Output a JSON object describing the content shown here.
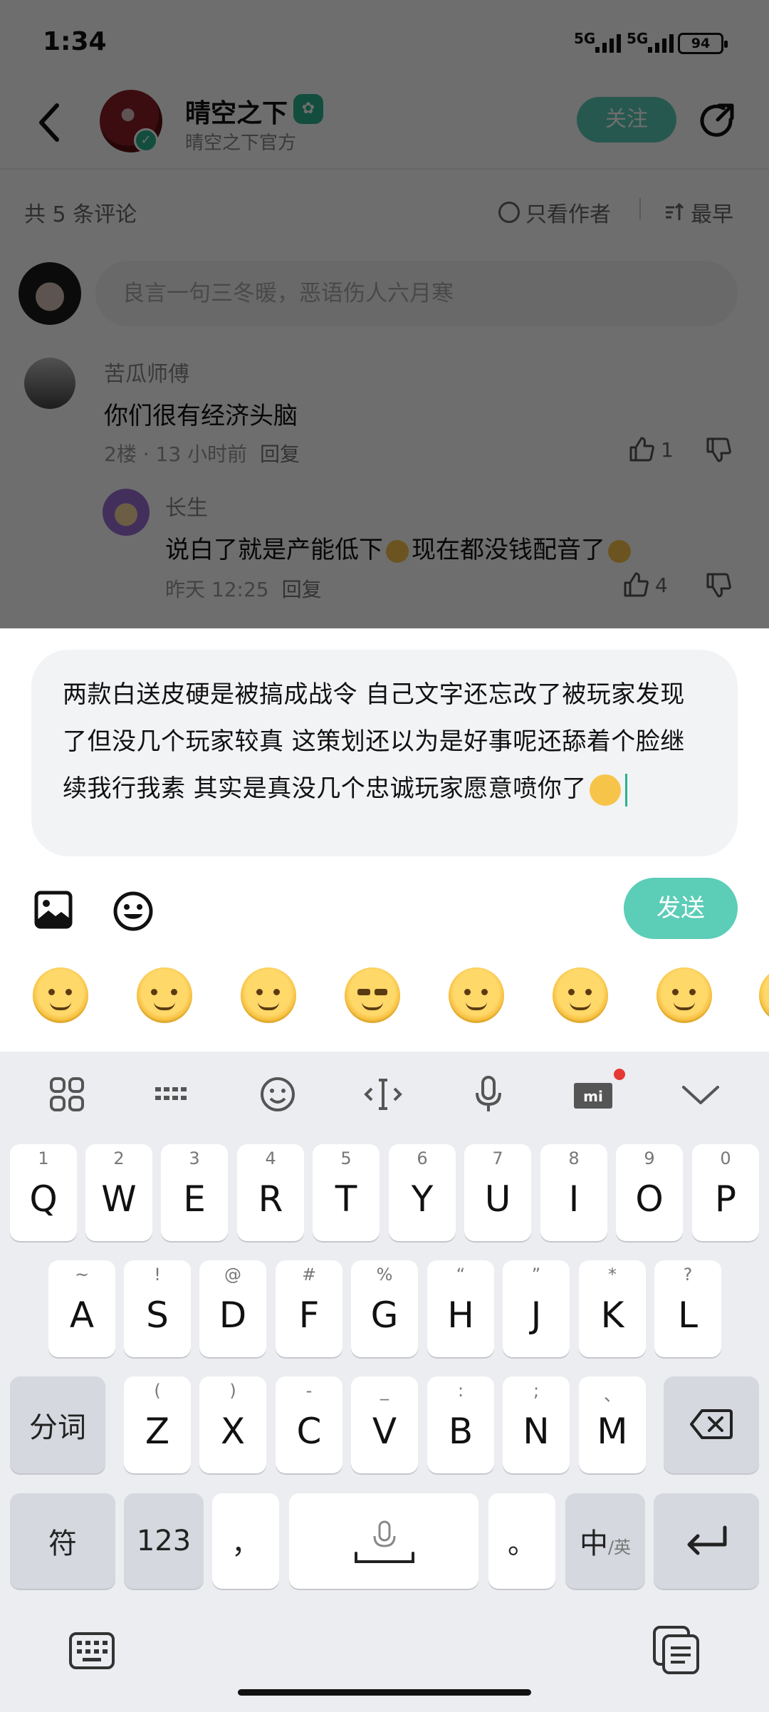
{
  "status": {
    "time": "1:34",
    "sig1": "5G",
    "sig2": "5G",
    "battery": "94"
  },
  "header": {
    "name": "晴空之下",
    "subtitle": "晴空之下官方",
    "follow_label": "关注"
  },
  "comments_bar": {
    "count_label": "共 5 条评论",
    "only_author_label": "只看作者",
    "sort_label": "最早"
  },
  "comment_input": {
    "placeholder": "良言一句三冬暖，恶语伤人六月寒"
  },
  "comments": [
    {
      "user": "苦瓜师傅",
      "text": "你们很有经济头脑",
      "meta": "2楼 · 13 小时前",
      "reply": "回复",
      "likes": "1"
    },
    {
      "user": "长生",
      "text_a": "说白了就是产能低下",
      "text_b": "现在都没钱配音了",
      "meta": "昨天 12:25",
      "reply": "回复",
      "likes": "4"
    }
  ],
  "compose": {
    "text": "两款白送皮硬是被搞成战令 自己文字还忘改了被玩家发现了但没几个玩家较真 这策划还以为是好事呢还舔着个脸继续我行我素 其实是真没几个忠诚玩家愿意喷你了",
    "send_label": "发送"
  },
  "keyboard": {
    "row1": [
      {
        "k": "Q",
        "s": "1"
      },
      {
        "k": "W",
        "s": "2"
      },
      {
        "k": "E",
        "s": "3"
      },
      {
        "k": "R",
        "s": "4"
      },
      {
        "k": "T",
        "s": "5"
      },
      {
        "k": "Y",
        "s": "6"
      },
      {
        "k": "U",
        "s": "7"
      },
      {
        "k": "I",
        "s": "8"
      },
      {
        "k": "O",
        "s": "9"
      },
      {
        "k": "P",
        "s": "0"
      }
    ],
    "row2": [
      {
        "k": "A",
        "s": "~"
      },
      {
        "k": "S",
        "s": "!"
      },
      {
        "k": "D",
        "s": "@"
      },
      {
        "k": "F",
        "s": "#"
      },
      {
        "k": "G",
        "s": "%"
      },
      {
        "k": "H",
        "s": "“"
      },
      {
        "k": "J",
        "s": "”"
      },
      {
        "k": "K",
        "s": "*"
      },
      {
        "k": "L",
        "s": "?"
      }
    ],
    "row3": [
      {
        "k": "Z",
        "s": "("
      },
      {
        "k": "X",
        "s": ")"
      },
      {
        "k": "C",
        "s": "-"
      },
      {
        "k": "V",
        "s": "_"
      },
      {
        "k": "B",
        "s": ":"
      },
      {
        "k": "N",
        "s": ";"
      },
      {
        "k": "M",
        "s": "、"
      }
    ],
    "fenci": "分词",
    "fu": "符",
    "num": "123",
    "comma": "，",
    "period": "。",
    "lang_main": "中",
    "lang_sub": "/英"
  },
  "colors": {
    "accent": "#5ccdb7",
    "verified": "#2ab38e"
  }
}
